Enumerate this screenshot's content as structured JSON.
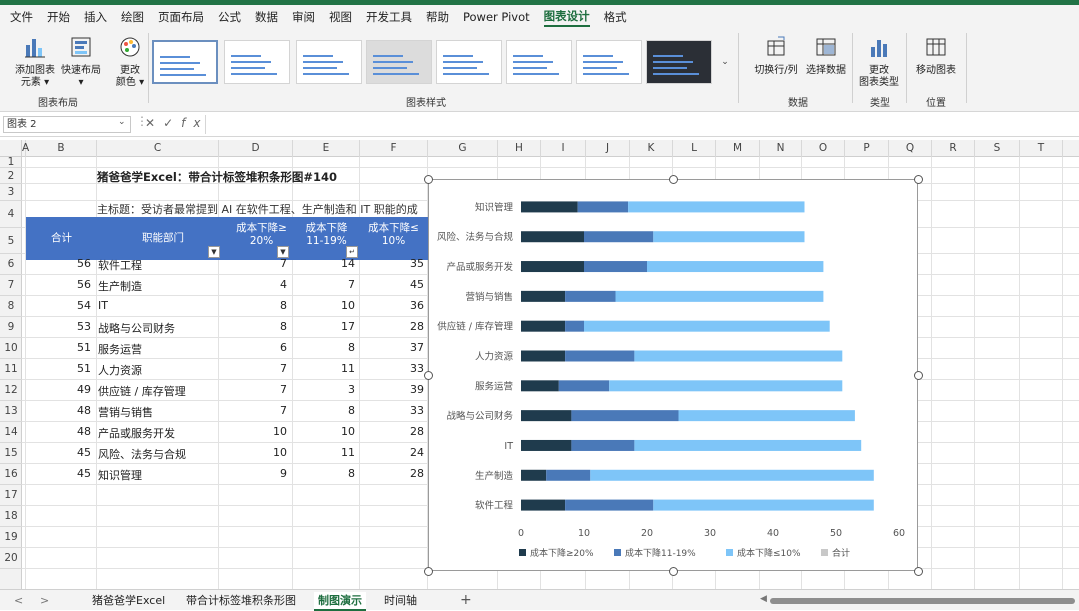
{
  "menu": [
    "文件",
    "开始",
    "插入",
    "绘图",
    "页面布局",
    "公式",
    "数据",
    "审阅",
    "视图",
    "开发工具",
    "帮助",
    "Power Pivot",
    "图表设计",
    "格式"
  ],
  "menu_active_index": 12,
  "ribbon": {
    "add_element": "添加图表\n元素 ▾",
    "quick_layout": "快速布局\n▾",
    "change_colors": "更改\n颜色 ▾",
    "group_layout": "图表布局",
    "group_styles": "图表样式",
    "switch_rowcol": "切换行/列",
    "select_data": "选择数据",
    "group_data": "数据",
    "change_type": "更改\n图表类型",
    "group_type": "类型",
    "move_chart": "移动图表",
    "group_location": "位置"
  },
  "formula_bar": {
    "name_box": "图表 2",
    "fx": "fx",
    "value": ""
  },
  "columns": [
    "A",
    "B",
    "C",
    "D",
    "E",
    "F",
    "G",
    "H",
    "I",
    "J",
    "K",
    "L",
    "M",
    "N",
    "O",
    "P",
    "Q",
    "R",
    "S",
    "T"
  ],
  "rows": [
    "1",
    "2",
    "3",
    "4",
    "5",
    "6",
    "7",
    "8",
    "9",
    "10",
    "11",
    "12",
    "13",
    "14",
    "15",
    "16",
    "17",
    "18",
    "19",
    "20"
  ],
  "sheet": {
    "title": "猪爸爸学Excel：带合计标签堆积条形图#140",
    "subtitle": "主标题：受访者最常提到 AI 在软件工程、生产制造和 IT 职能的成",
    "headers": {
      "total": "合计",
      "dept": "职能部门",
      "c1": "成本下降≥\n20%",
      "c2": "成本下降\n11-19%",
      "c3": "成本下降≤\n10%"
    },
    "rows": [
      {
        "total": 56,
        "dept": "软件工程",
        "a": 7,
        "b": 14,
        "c": 35
      },
      {
        "total": 56,
        "dept": "生产制造",
        "a": 4,
        "b": 7,
        "c": 45
      },
      {
        "total": 54,
        "dept": "IT",
        "a": 8,
        "b": 10,
        "c": 36
      },
      {
        "total": 53,
        "dept": "战略与公司财务",
        "a": 8,
        "b": 17,
        "c": 28
      },
      {
        "total": 51,
        "dept": "服务运营",
        "a": 6,
        "b": 8,
        "c": 37
      },
      {
        "total": 51,
        "dept": "人力资源",
        "a": 7,
        "b": 11,
        "c": 33
      },
      {
        "total": 49,
        "dept": "供应链 / 库存管理",
        "a": 7,
        "b": 3,
        "c": 39
      },
      {
        "total": 48,
        "dept": "营销与销售",
        "a": 7,
        "b": 8,
        "c": 33
      },
      {
        "total": 48,
        "dept": "产品或服务开发",
        "a": 10,
        "b": 10,
        "c": 28
      },
      {
        "total": 45,
        "dept": "风险、法务与合规",
        "a": 10,
        "b": 11,
        "c": 24
      },
      {
        "total": 45,
        "dept": "知识管理",
        "a": 9,
        "b": 8,
        "c": 28
      }
    ]
  },
  "chart_data": {
    "type": "bar",
    "orientation": "horizontal",
    "stacked": true,
    "categories": [
      "知识管理",
      "风险、法务与合规",
      "产品或服务开发",
      "营销与销售",
      "供应链 / 库存管理",
      "人力资源",
      "服务运营",
      "战略与公司财务",
      "IT",
      "生产制造",
      "软件工程"
    ],
    "series": [
      {
        "name": "成本下降≥20%",
        "color": "#1f3b4d",
        "values": [
          9,
          10,
          10,
          7,
          7,
          7,
          6,
          8,
          8,
          4,
          7
        ]
      },
      {
        "name": "成本下降11-19%",
        "color": "#4a79b8",
        "values": [
          8,
          11,
          10,
          8,
          3,
          11,
          8,
          17,
          10,
          7,
          14
        ]
      },
      {
        "name": "成本下降≤10%",
        "color": "#7ec5f8",
        "values": [
          28,
          24,
          28,
          33,
          39,
          33,
          37,
          28,
          36,
          45,
          35
        ]
      },
      {
        "name": "合计",
        "color": "#c8c8c8",
        "values": []
      }
    ],
    "xlim": [
      0,
      60
    ],
    "xticks": [
      "0",
      "10",
      "20",
      "30",
      "40",
      "50",
      "60"
    ],
    "legend_position": "bottom",
    "grid": false
  },
  "sheet_tabs": [
    "猪爸爸学Excel",
    "带合计标签堆积条形图",
    "制图演示",
    "时间轴"
  ],
  "sheet_tab_active": 2,
  "nav": {
    "prev": "<",
    "next": ">",
    "add": "+"
  }
}
